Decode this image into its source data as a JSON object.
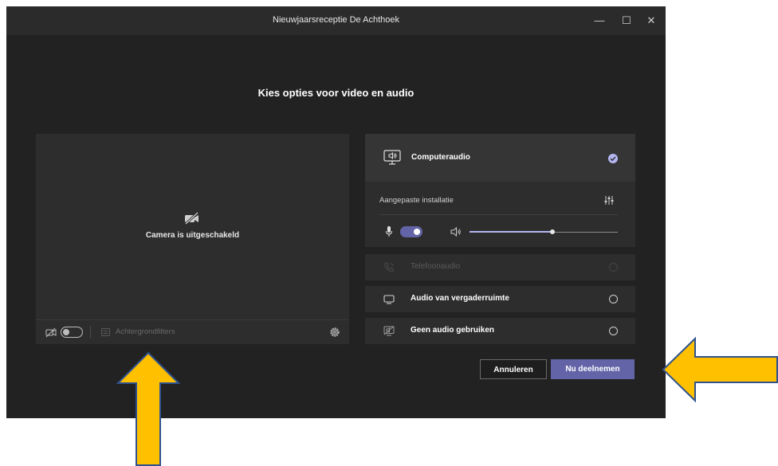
{
  "window": {
    "title": "Nieuwjaarsreceptie De Achthoek",
    "controls": {
      "minimize": "—",
      "maximize": "☐",
      "close": "✕"
    }
  },
  "heading": "Kies opties voor video en audio",
  "video": {
    "camera_status": "Camera is uitgeschakeld",
    "camera_on": false,
    "background_filters_label": "Achtergrondfilters"
  },
  "audio": {
    "computer_audio": {
      "label": "Computeraudio",
      "selected": true
    },
    "custom_setup_label": "Aangepaste installatie",
    "microphone_on": true,
    "volume_level": 0.56,
    "options": [
      {
        "label": "Telefoonaudio",
        "enabled": false,
        "icon": "phone-icon"
      },
      {
        "label": "Audio van vergaderruimte",
        "enabled": true,
        "icon": "room-audio-icon"
      },
      {
        "label": "Geen audio gebruiken",
        "enabled": true,
        "icon": "no-audio-icon"
      }
    ]
  },
  "buttons": {
    "cancel": "Annuleren",
    "join": "Nu deelnemen"
  },
  "colors": {
    "accent": "#6264a7",
    "annotation_arrow": "#ffc000",
    "annotation_arrow_border": "#2f528f"
  }
}
